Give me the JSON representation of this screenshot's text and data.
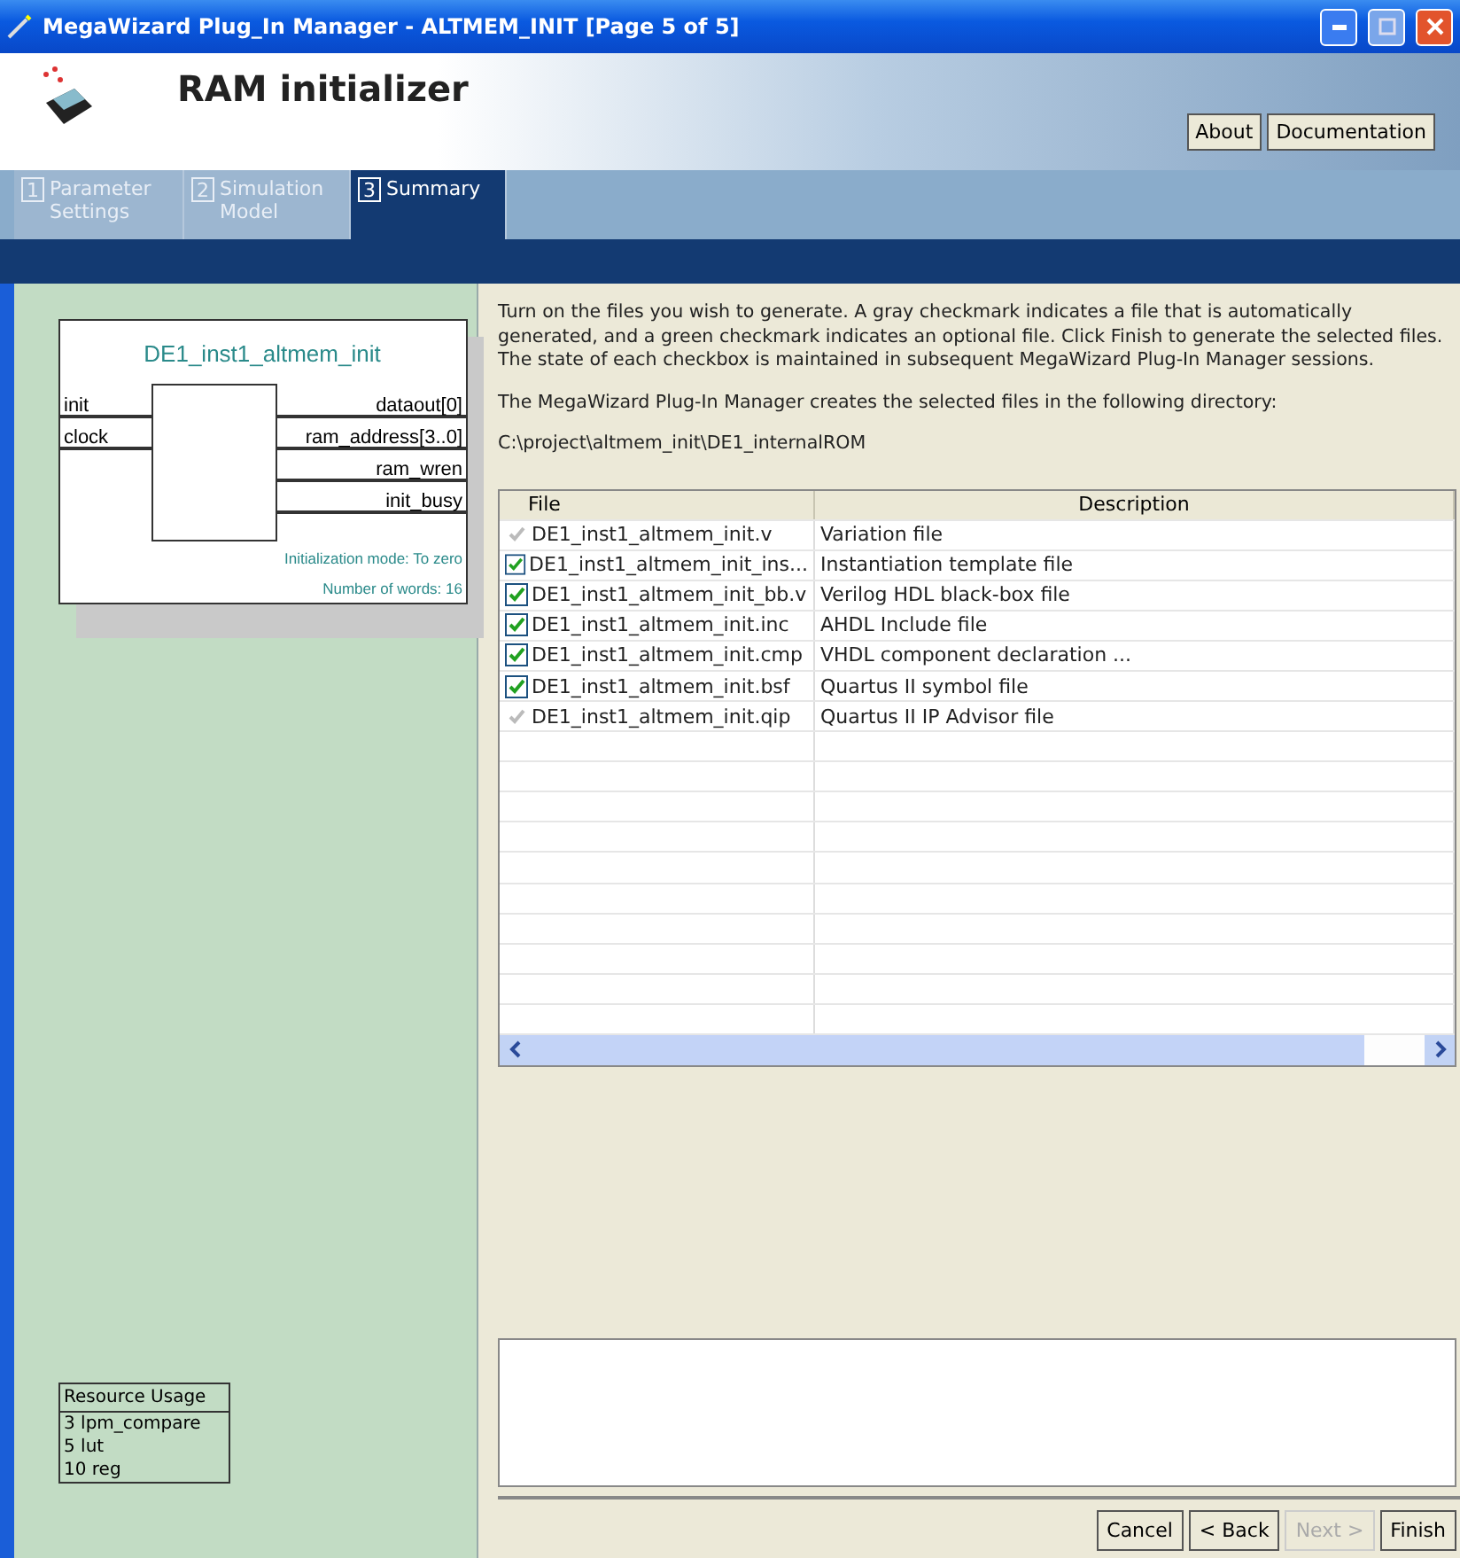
{
  "window": {
    "title": "MegaWizard Plug_In Manager - ALTMEM_INIT [Page 5 of 5]"
  },
  "header": {
    "title": "RAM initializer",
    "buttons": [
      "About",
      "Documentation"
    ]
  },
  "tabs": [
    {
      "number": "1",
      "label": "Parameter Settings",
      "selected": false
    },
    {
      "number": "2",
      "label": "Simulation Model",
      "selected": false
    },
    {
      "number": "3",
      "label": "Summary",
      "selected": true
    }
  ],
  "symbol": {
    "name": "DE1_inst1_altmem_init",
    "inputs": [
      "init",
      "clock"
    ],
    "outputs": [
      "dataout[0]",
      "ram_address[3..0]",
      "ram_wren",
      "init_busy"
    ],
    "notes": [
      "Initialization mode: To zero",
      "Number of words: 16"
    ]
  },
  "resource_usage": {
    "title": "Resource Usage",
    "items": [
      "3 lpm_compare",
      "5 lut",
      "10 reg"
    ]
  },
  "instructions": "Turn on the files you wish to generate. A gray checkmark indicates a file that is automatically generated, and a green checkmark indicates an optional file. Click Finish to generate the selected files. The state of each checkbox is maintained in subsequent MegaWizard Plug-In Manager sessions.",
  "directory_label": "The MegaWizard Plug-In Manager creates the selected files in the following directory:",
  "directory": "C:\\project\\altmem_init\\DE1_internalROM",
  "table": {
    "columns": [
      "File",
      "Description"
    ],
    "rows": [
      {
        "file": "DE1_inst1_altmem_init.v",
        "description": "Variation file",
        "checked": true,
        "disabled": true
      },
      {
        "file": "DE1_inst1_altmem_init_ins...",
        "description": "Instantiation template file",
        "checked": true,
        "disabled": false
      },
      {
        "file": "DE1_inst1_altmem_init_bb.v",
        "description": "Verilog HDL black-box file",
        "checked": true,
        "disabled": false
      },
      {
        "file": "DE1_inst1_altmem_init.inc",
        "description": "AHDL Include file",
        "checked": true,
        "disabled": false
      },
      {
        "file": "DE1_inst1_altmem_init.cmp",
        "description": "VHDL component declaration ...",
        "checked": true,
        "disabled": false
      },
      {
        "file": "DE1_inst1_altmem_init.bsf",
        "description": "Quartus II symbol file",
        "checked": true,
        "disabled": false
      },
      {
        "file": "DE1_inst1_altmem_init.qip",
        "description": "Quartus II IP Advisor file",
        "checked": true,
        "disabled": true
      }
    ]
  },
  "footer_buttons": [
    {
      "label": "Cancel",
      "disabled": false
    },
    {
      "label": "< Back",
      "disabled": false
    },
    {
      "label": "Next >",
      "disabled": true
    },
    {
      "label": "Finish",
      "disabled": false
    }
  ]
}
